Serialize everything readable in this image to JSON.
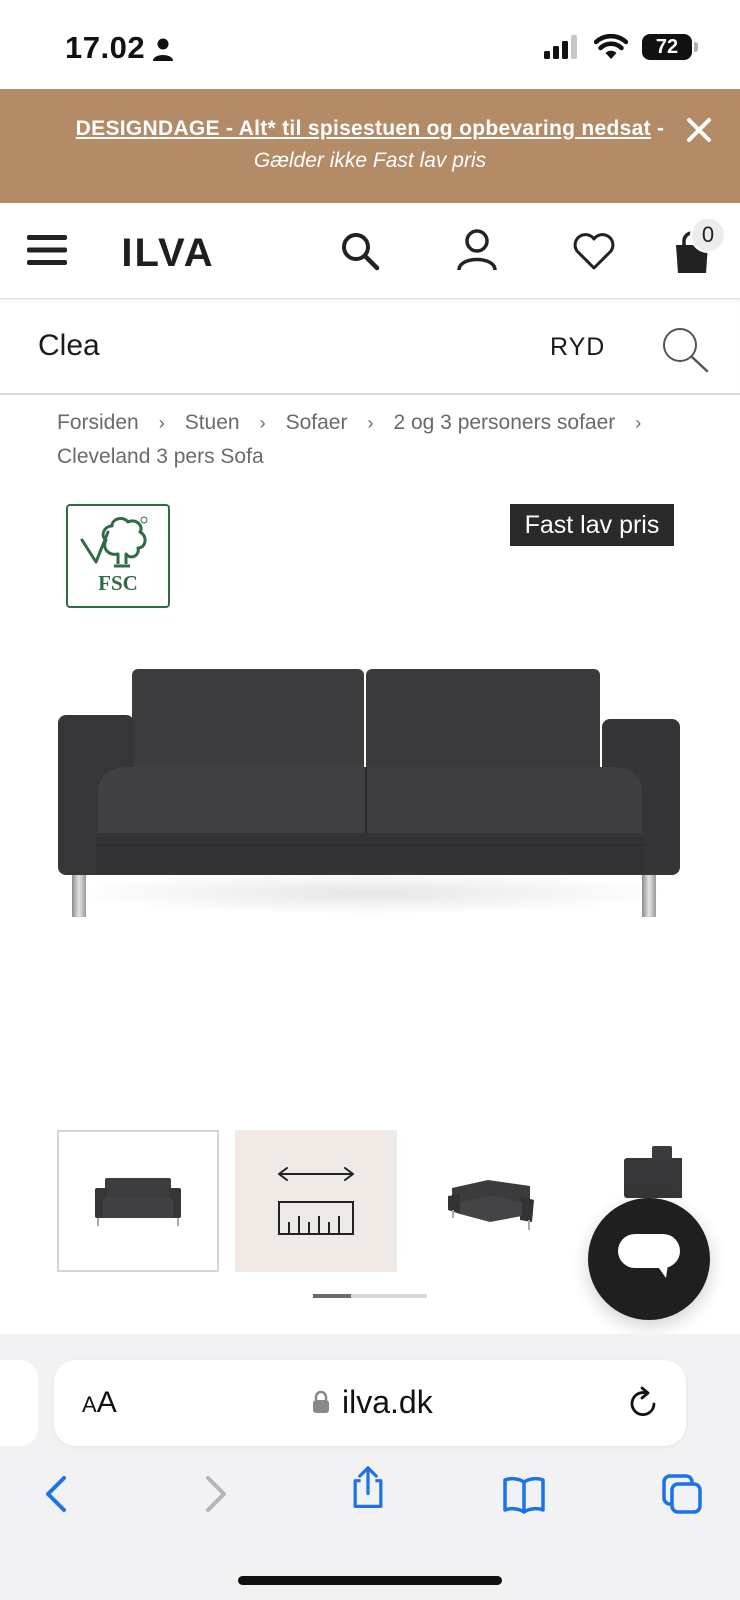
{
  "status_bar": {
    "time": "17.02",
    "battery": "72"
  },
  "promo": {
    "link_text": "DESIGNDAGE - Alt* til spisestuen og opbevaring nedsat",
    "separator": " -",
    "subtext": "Gælder ikke Fast lav pris",
    "background": "#b38b67"
  },
  "header": {
    "logo": "ILVA",
    "cart_count": "0"
  },
  "search": {
    "value": "Clea",
    "clear_label": "RYD"
  },
  "breadcrumb": [
    "Forsiden",
    "Stuen",
    "Sofaer",
    "2 og 3 personers sofaer",
    "Cleveland 3 pers Sofa"
  ],
  "product": {
    "badge_label": "FSC",
    "price_tag": "Fast lav pris"
  },
  "thumbnail_scroll_fraction": 0.33,
  "browser": {
    "aa_small": "A",
    "aa_large": "A",
    "url": "ilva.dk",
    "accent": "#1a73e8"
  },
  "icons": [
    "person-icon",
    "signal-icon",
    "wifi-icon",
    "battery-icon",
    "close-icon",
    "menu-icon",
    "search-icon",
    "user-icon",
    "heart-icon",
    "bag-icon",
    "chat-icon",
    "lock-icon",
    "reload-icon",
    "back-icon",
    "forward-icon",
    "share-icon",
    "bookmarks-icon",
    "tabs-icon"
  ]
}
